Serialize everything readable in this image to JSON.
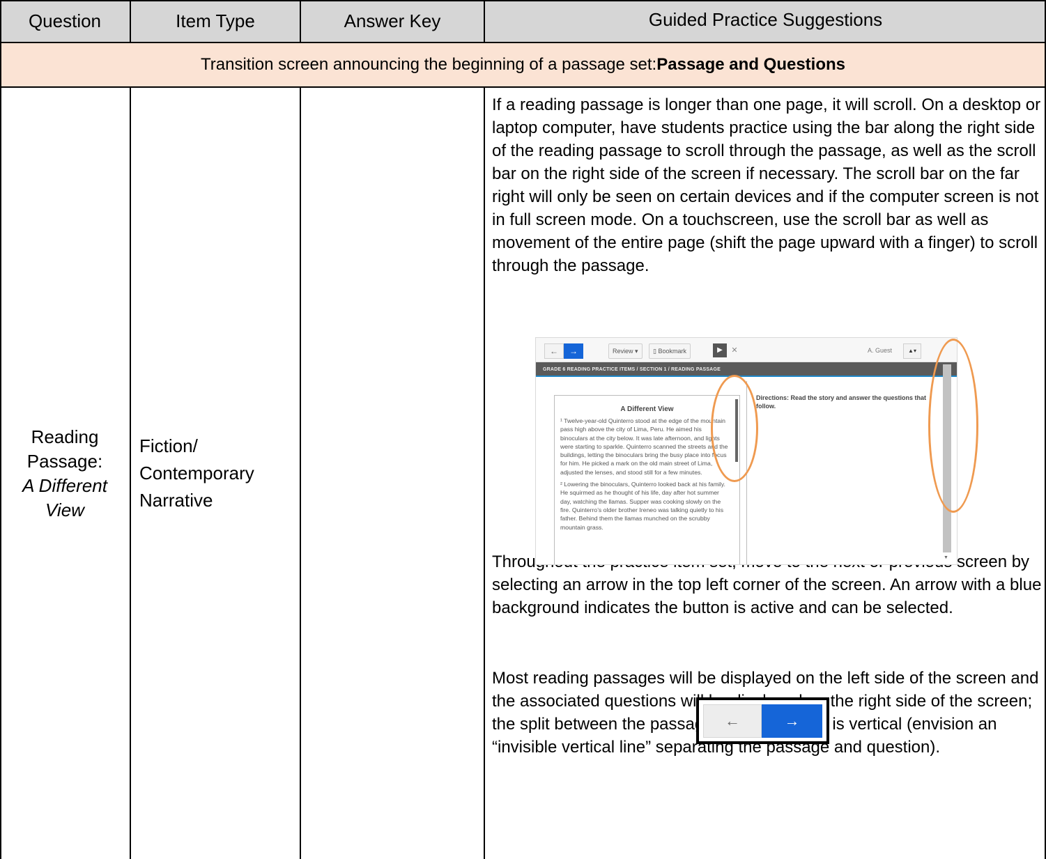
{
  "header": {
    "question": "Question",
    "item_type": "Item Type",
    "answer_key": "Answer Key",
    "guided": "Guided Practice Suggestions"
  },
  "transition": {
    "text": "Transition screen announcing the beginning of a passage set: ",
    "bold": "Passage and Questions"
  },
  "row": {
    "question_line1": "Reading",
    "question_line2": "Passage:",
    "question_line3": "A Different",
    "question_line4": "View",
    "type_line1": "Fiction/",
    "type_line2": "Contemporary",
    "type_line3": "Narrative",
    "answer_key": "",
    "para1": "If a reading passage is longer than one page, it will scroll.  On a desktop or laptop computer, have students practice using the bar along the right side of the reading passage to scroll through the passage, as well as the scroll bar on the right side of the screen if necessary.  The scroll bar on the far right will only be seen on certain devices and if the computer screen is not in full screen mode.  On a touchscreen, use the scroll bar as well as movement of the entire page (shift the page upward with a finger) to scroll through the passage.",
    "para2": "Throughout the practice item set, move to the next or previous screen by selecting an arrow in the top left corner of the screen.  An arrow with a blue background indicates the button is active and can be selected.",
    "para3": "Most reading passages will be displayed on the left side of the screen and the associated questions will be displayed on the right side of the screen; the split between the passage and a question is vertical (envision an “invisible vertical line” separating the passage and question)."
  },
  "screenshot": {
    "back_arrow": "←",
    "next_arrow": "→",
    "review": "Review ▾",
    "bookmark": "Bookmark",
    "pointer": "▶",
    "close": "✕",
    "user": "A. Guest",
    "user_btn": "▲▾",
    "breadcrumb": "GRADE 6 READING PRACTICE ITEMS  /  SECTION 1  /  READING PASSAGE",
    "passage_title": "A Different View",
    "passage_p1": "¹ Twelve-year-old Quinterro stood at the edge of the mountain pass high above the city of Lima, Peru. He aimed his binoculars at the city below. It was late afternoon, and lights were starting to sparkle. Quinterro scanned the streets and the buildings, letting the binoculars bring the busy place into focus for him. He picked a mark on the old main street of Lima, adjusted the lenses, and stood still for a few minutes.",
    "passage_p2": "² Lowering the binoculars, Quinterro looked back at his family. He squirmed as he thought of his life, day after hot summer day, watching the llamas. Supper was cooking slowly on the fire. Quinterro’s older brother Ireneo was talking quietly to his father. Behind them the llamas munched on the scrubby mountain grass.",
    "directions": "Directions: Read the story and answer the questions that follow."
  },
  "arrow_buttons": {
    "left": "←",
    "right": "→"
  },
  "colors": {
    "header_bg": "#d6d6d6",
    "transition_bg": "#fbe3d4",
    "highlight": "#ef9a50",
    "active_blue": "#1565d8"
  }
}
